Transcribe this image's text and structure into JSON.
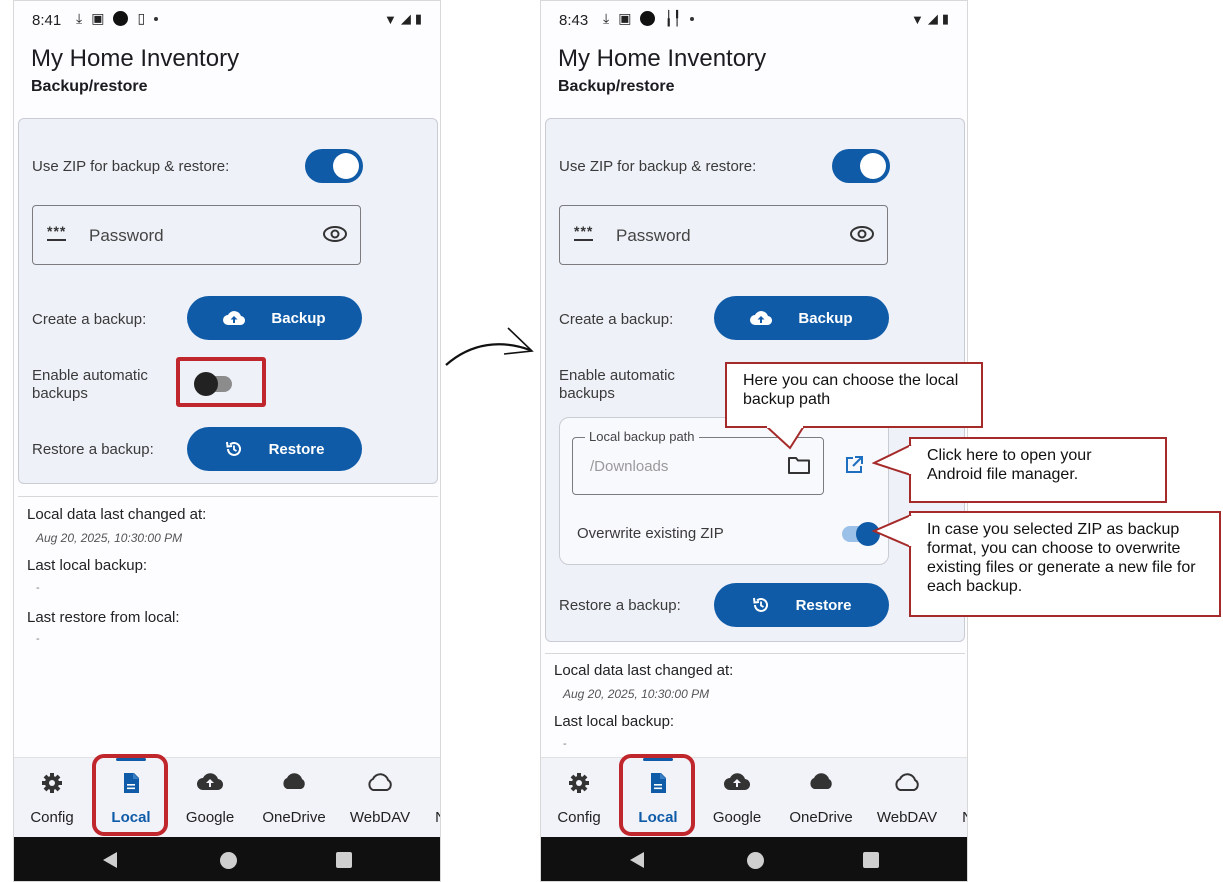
{
  "left": {
    "status": {
      "time": "8:41"
    },
    "app_title": "My Home Inventory",
    "subtitle": "Backup/restore",
    "zip_label": "Use ZIP for backup & restore:",
    "password_placeholder": "Password",
    "create_backup_label": "Create a backup:",
    "backup_button": "Backup",
    "auto_backup_label": "Enable automatic backups",
    "restore_label": "Restore a backup:",
    "restore_button": "Restore",
    "info": {
      "local_changed_label": "Local data last changed at:",
      "local_changed_value": "Aug 20, 2025, 10:30:00 PM",
      "last_backup_label": "Last local backup:",
      "last_backup_value": "-",
      "last_restore_label": "Last restore from local:",
      "last_restore_value": "-"
    },
    "nav": [
      "Config",
      "Local",
      "Google",
      "OneDrive",
      "WebDAV"
    ],
    "nav_more": "N"
  },
  "right": {
    "status": {
      "time": "8:43"
    },
    "app_title": "My Home Inventory",
    "subtitle": "Backup/restore",
    "zip_label": "Use ZIP for backup & restore:",
    "password_placeholder": "Password",
    "create_backup_label": "Create a backup:",
    "backup_button": "Backup",
    "auto_backup_label": "Enable automatic backups",
    "local_path_legend": "Local backup path",
    "local_path_value": "/Downloads",
    "overwrite_label": "Overwrite existing ZIP",
    "restore_label": "Restore a backup:",
    "restore_button": "Restore",
    "info": {
      "local_changed_label": "Local data last changed at:",
      "local_changed_value": "Aug 20, 2025, 10:30:00 PM",
      "last_backup_label": "Last local backup:",
      "last_backup_value": "-"
    },
    "nav": [
      "Config",
      "Local",
      "Google",
      "OneDrive",
      "WebDAV"
    ],
    "nav_more": "N"
  },
  "callouts": {
    "path": "Here you can choose the local backup path",
    "file_manager": "Click here to open your Android file manager.",
    "overwrite": "In case you selected ZIP as backup format, you can choose to overwrite existing files or generate a new file for each backup."
  },
  "colors": {
    "accent": "#0f5ba7",
    "highlight": "#c0272d",
    "callout_border": "#a52a2a"
  }
}
